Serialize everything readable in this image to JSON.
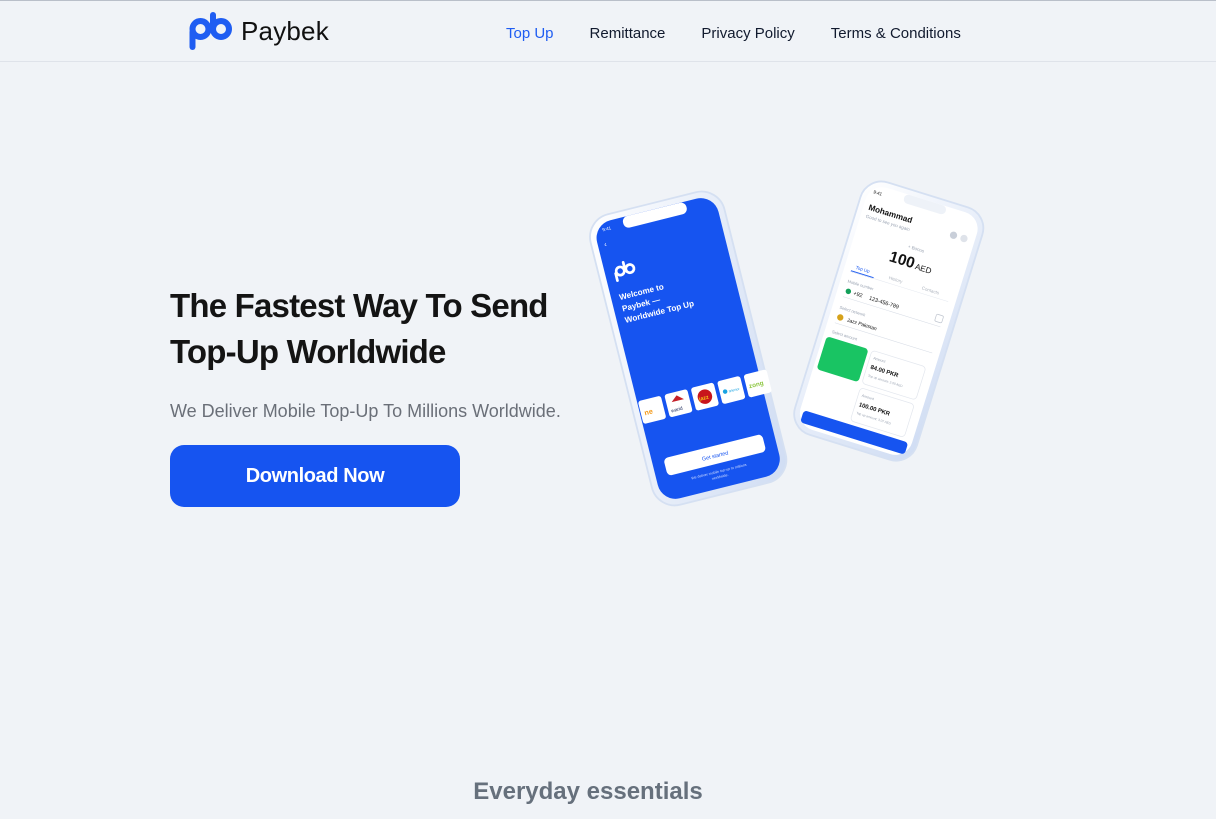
{
  "brand": {
    "name": "Paybek"
  },
  "nav": {
    "items": [
      {
        "label": "Top Up",
        "active": true
      },
      {
        "label": "Remittance",
        "active": false
      },
      {
        "label": "Privacy Policy",
        "active": false
      },
      {
        "label": "Terms & Conditions",
        "active": false
      }
    ]
  },
  "hero": {
    "title_line1": "The Fastest Way To Send",
    "title_line2": "Top-Up Worldwide",
    "subtitle": "We Deliver Mobile Top-Up To Millions Worldwide.",
    "cta_label": "Download Now"
  },
  "phone_front": {
    "time": "9:41",
    "welcome_line1": "Welcome to",
    "welcome_line2": "Paybek —",
    "welcome_line3": "Worldwide Top Up",
    "operators": [
      "ne",
      "warid",
      "jazz",
      "telenor",
      "zong"
    ],
    "get_started": "Get started",
    "footer_line1": "We deliver mobile top-up to millions",
    "footer_line2": "worldwide."
  },
  "phone_back": {
    "time": "9:41",
    "user_name": "Mohammad",
    "greeting": "Good to see you again",
    "bonus_label": "+ Bonus",
    "balance": "100",
    "currency": "AED",
    "tabs": [
      "Top Up",
      "History",
      "Contacts"
    ],
    "mobile_label": "Mobile number",
    "country_code": "+92",
    "phone_number": "123-456-789",
    "network_label": "Select network",
    "network": "Jazz Pakistan",
    "amount_label": "Select amount",
    "amounts": [
      {
        "title": "Amount",
        "value": "84.00 PKR",
        "sub": "Top up amount: 2.00 AED"
      },
      {
        "title": "Amount",
        "value": "100.00 PKR",
        "sub": "Top up amount: 3.07 AED"
      }
    ]
  },
  "colors": {
    "accent": "#1f5df2",
    "button": "#1654f0",
    "green": "#19c463"
  },
  "sections": {
    "essentials_title": "Everyday essentials"
  }
}
